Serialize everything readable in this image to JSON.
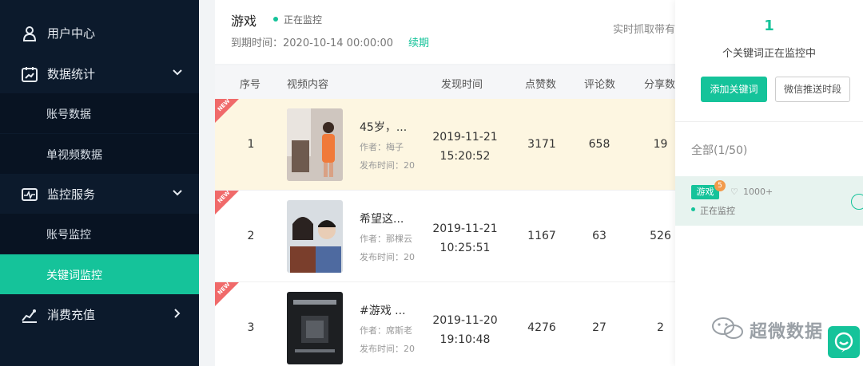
{
  "sidebar": {
    "user_center": "用户中心",
    "data_stats": "数据统计",
    "account_data": "账号数据",
    "single_video_data": "单视频数据",
    "monitor_service": "监控服务",
    "account_monitor": "账号监控",
    "keyword_monitor": "关键词监控",
    "recharge": "消费充值"
  },
  "header": {
    "keyword": "游戏",
    "status": "正在监控",
    "expiry": "到期时间：2020-10-14 00:00:00",
    "renew": "续期",
    "realtime": "实时抓取带有"
  },
  "table": {
    "columns": [
      "序号",
      "视频内容",
      "发现时间",
      "点赞数",
      "评论数",
      "分享数"
    ],
    "new_badge": "NEW",
    "rows": [
      {
        "idx": "1",
        "title": "45岁，...",
        "author": "作者：梅子",
        "published": "发布时间：20",
        "date": "2019-11-21",
        "time": "15:20:52",
        "likes": "3171",
        "comments": "658",
        "shares": "19"
      },
      {
        "idx": "2",
        "title": "希望这...",
        "author": "作者：那棵云",
        "published": "发布时间：20",
        "date": "2019-11-21",
        "time": "10:25:51",
        "likes": "1167",
        "comments": "63",
        "shares": "526"
      },
      {
        "idx": "3",
        "title": "#游戏 ...",
        "author": "作者：席斯老",
        "published": "发布时间：20",
        "date": "2019-11-20",
        "time": "19:10:48",
        "likes": "4276",
        "comments": "27",
        "shares": "2"
      }
    ]
  },
  "panel": {
    "count": "1",
    "desc": "个关键词正在监控中",
    "add_button": "添加关键词",
    "push_button": "微信推送时段",
    "filter": "全部(1/50)",
    "item": {
      "tag": "游戏",
      "badge": "5",
      "likes": "1000+",
      "status": "正在监控"
    }
  },
  "watermark": "超微数据",
  "colors": {
    "accent": "#15c39a",
    "sidebar": "#0c1a2c",
    "new_ribbon": "#f06a6a"
  }
}
